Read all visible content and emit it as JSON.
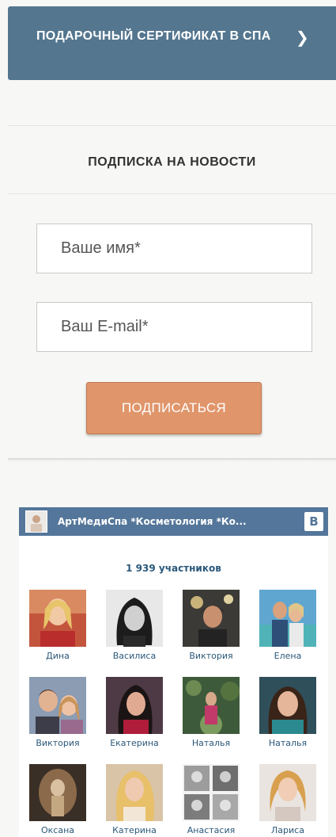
{
  "certificate": {
    "label": "ПОДАРОЧНЫЙ СЕРТИФИКАТ В СПА",
    "chevron_icon": "chevron-right-icon"
  },
  "newsletter": {
    "heading": "ПОДПИСКА НА НОВОСТИ",
    "name_placeholder": "Ваше имя*",
    "name_value": "",
    "email_placeholder": "Ваш E-mail*",
    "email_value": "",
    "submit_label": "ПОДПИСАТЬСЯ",
    "button_color": "#e0956a"
  },
  "vk_widget": {
    "group_name": "АртМедиСпа *Косметология *Ко...",
    "logo_text": "В",
    "member_count": "1 939 участников",
    "header_color": "#54769a",
    "members": [
      {
        "name": "Дина"
      },
      {
        "name": "Василиса"
      },
      {
        "name": "Виктория"
      },
      {
        "name": "Елена"
      },
      {
        "name": "Виктория"
      },
      {
        "name": "Екатерина"
      },
      {
        "name": "Наталья"
      },
      {
        "name": "Наталья"
      },
      {
        "name": "Оксана"
      },
      {
        "name": "Катерина"
      },
      {
        "name": "Анастасия"
      },
      {
        "name": "Лариса"
      }
    ]
  }
}
